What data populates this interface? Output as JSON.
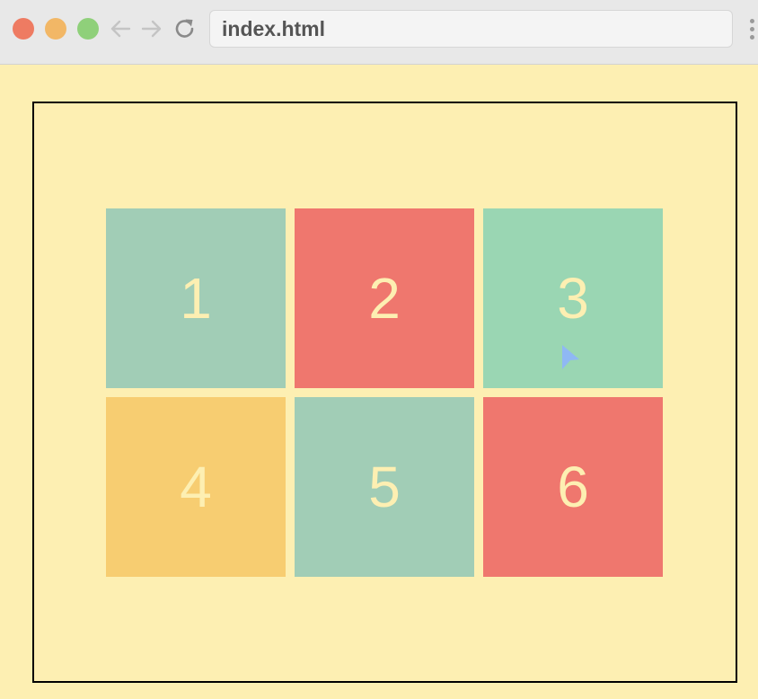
{
  "browser": {
    "url": "index.html",
    "window_controls": [
      {
        "name": "close",
        "color": "#ee7b62"
      },
      {
        "name": "minimize",
        "color": "#f2b766"
      },
      {
        "name": "maximize",
        "color": "#8fd07a"
      }
    ],
    "nav_icons": [
      "back-arrow-icon",
      "forward-arrow-icon",
      "reload-icon",
      "menu-dots-icon"
    ]
  },
  "page": {
    "background": "#fdefb2",
    "cells": [
      {
        "label": "1",
        "color": "#a1cdb6"
      },
      {
        "label": "2",
        "color": "#ef776e"
      },
      {
        "label": "3",
        "color": "#9ad6b3"
      },
      {
        "label": "4",
        "color": "#f7cd71"
      },
      {
        "label": "5",
        "color": "#a1cdb6"
      },
      {
        "label": "6",
        "color": "#ef776e"
      }
    ]
  }
}
